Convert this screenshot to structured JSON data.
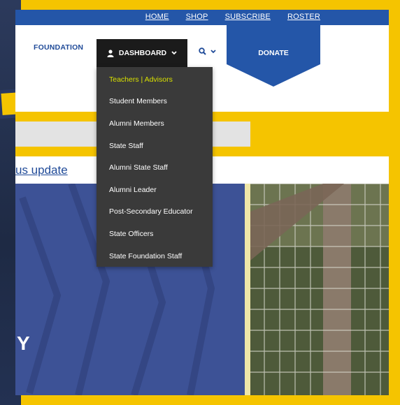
{
  "top_links": [
    "HOME",
    "SHOP",
    "SUBSCRIBE",
    "ROSTER"
  ],
  "nav": {
    "foundation": "FOUNDATION",
    "dashboard": "DASHBOARD",
    "donate": "DONATE",
    "search_icon": "search-icon"
  },
  "dropdown": {
    "items": [
      "Teachers | Advisors",
      "Student Members",
      "Alumni Members",
      "State Staff",
      "Alumni State Staff",
      "Alumni Leader",
      "Post-Secondary Educator",
      "State Officers",
      "State Foundation Staff"
    ],
    "active_index": 0
  },
  "status_link": "us update",
  "hero_text": "Y",
  "colors": {
    "brand_blue": "#2456a8",
    "accent_yellow": "#f5c400",
    "menu_bg": "#3a3a3a",
    "active_item": "#d8e000"
  }
}
